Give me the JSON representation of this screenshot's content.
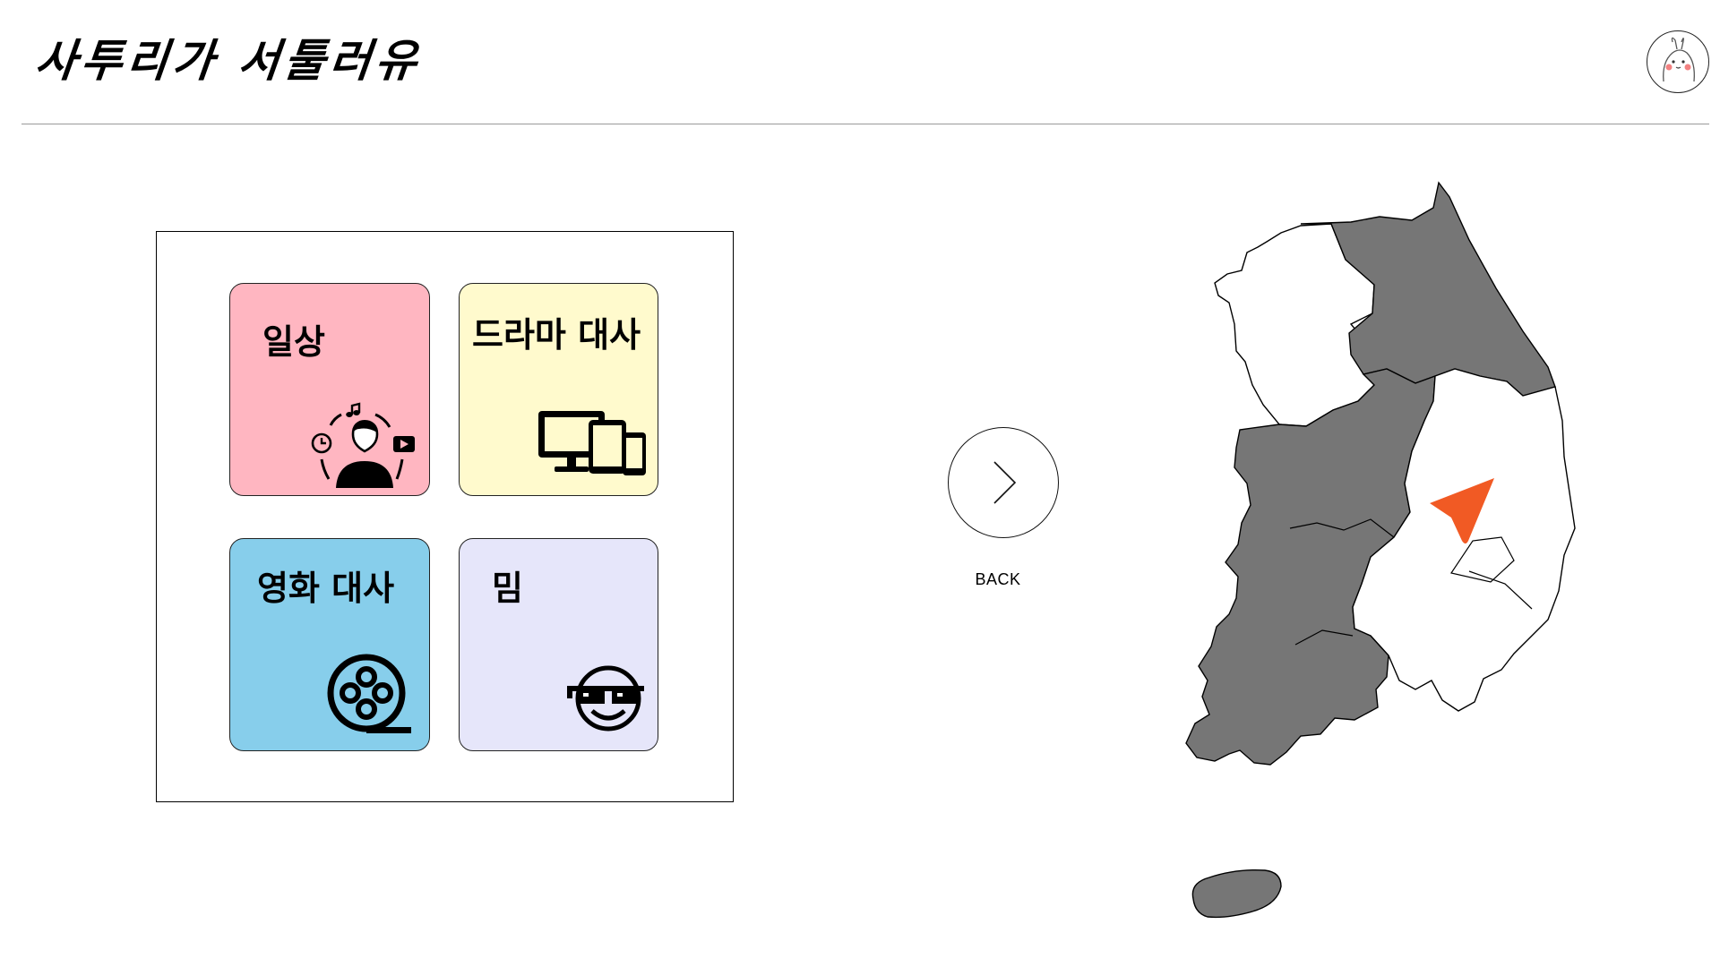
{
  "header": {
    "title": "사투리가 서툴러유",
    "avatar_icon": "bunny-avatar-icon"
  },
  "categories": [
    {
      "label": "일상",
      "icon": "daily-life-person-icon",
      "color": "#FFB6C1"
    },
    {
      "label": "드라마 대사",
      "icon": "devices-icon",
      "color": "#FFFACD"
    },
    {
      "label": "영화 대사",
      "icon": "film-reel-icon",
      "color": "#87CEEB"
    },
    {
      "label": "밈",
      "icon": "sunglasses-smiley-icon",
      "color": "#E6E6FA"
    }
  ],
  "navigation": {
    "back_label": "BACK",
    "back_icon": "chevron-right-icon"
  },
  "map": {
    "icon": "korea-map-icon",
    "marker_icon": "location-arrow-icon",
    "region_fill": "#767676",
    "marker_color": "#F15A24"
  }
}
